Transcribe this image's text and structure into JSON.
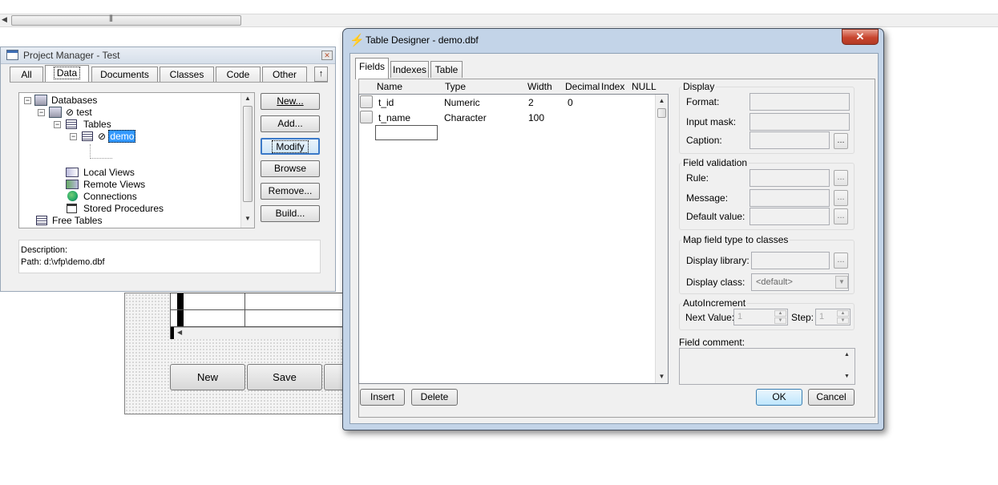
{
  "form_designer": {
    "buttons": [
      "New",
      "Save"
    ]
  },
  "project_manager": {
    "title": "Project Manager - Test",
    "tabs": [
      "All",
      "Data",
      "Documents",
      "Classes",
      "Code",
      "Other"
    ],
    "collapse_glyph": "↑",
    "tree": {
      "databases": "Databases",
      "db_test": "test",
      "tables": "Tables",
      "table_demo": "demo",
      "local_views": "Local Views",
      "remote_views": "Remote Views",
      "connections": "Connections",
      "stored_procedures": "Stored Procedures",
      "free_tables": "Free Tables"
    },
    "buttons": [
      "New...",
      "Add...",
      "Modify",
      "Browse",
      "Remove...",
      "Build..."
    ],
    "description_label": "Description:",
    "path_text": "Path: d:\\vfp\\demo.dbf"
  },
  "table_designer": {
    "title": "Table Designer - demo.dbf",
    "close_glyph": "✕",
    "tabs": [
      "Fields",
      "Indexes",
      "Table"
    ],
    "columns": [
      "Name",
      "Type",
      "Width",
      "Decimal",
      "Index",
      "NULL"
    ],
    "rows": [
      {
        "name": "t_id",
        "type": "Numeric",
        "width": "2",
        "decimal": "0"
      },
      {
        "name": "t_name",
        "type": "Character",
        "width": "100",
        "decimal": ""
      }
    ],
    "new_field_value": "",
    "display": {
      "title": "Display",
      "format": "Format:",
      "input_mask": "Input mask:",
      "caption": "Caption:"
    },
    "field_validation": {
      "title": "Field validation",
      "rule": "Rule:",
      "message": "Message:",
      "default_value": "Default value:"
    },
    "map_field": {
      "title": "Map field type to classes",
      "display_library": "Display library:",
      "display_class": "Display class:",
      "display_class_value": "<default>"
    },
    "auto_increment": {
      "title": "AutoIncrement",
      "next_value_label": "Next Value:",
      "next_value": "1",
      "step_label": "Step:",
      "step_value": "1"
    },
    "field_comment": "Field comment:",
    "ellipsis": "...",
    "buttons": {
      "insert": "Insert",
      "delete": "Delete",
      "ok": "OK",
      "cancel": "Cancel"
    }
  }
}
